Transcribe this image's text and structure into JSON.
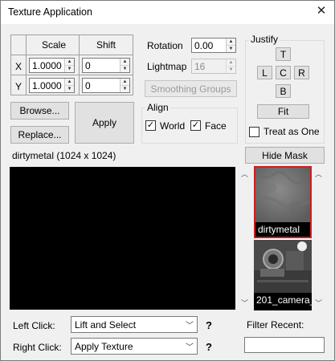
{
  "window": {
    "title": "Texture Application",
    "close_glyph": "✕"
  },
  "grid": {
    "col_scale": "Scale",
    "col_shift": "Shift",
    "row_x": "X",
    "row_y": "Y",
    "x_scale": "1.0000",
    "x_shift": "0",
    "y_scale": "1.0000",
    "y_shift": "0"
  },
  "rotation": {
    "label": "Rotation",
    "value": "0.00"
  },
  "lightmap": {
    "label": "Lightmap",
    "value": "16"
  },
  "smoothing_groups_label": "Smoothing Groups",
  "justify": {
    "label": "Justify",
    "top": "T",
    "left": "L",
    "center": "C",
    "right": "R",
    "bottom": "B",
    "fit": "Fit",
    "treat_as_one": "Treat as One",
    "treat_as_one_checked": false
  },
  "align": {
    "label": "Align",
    "world": "World",
    "world_checked": true,
    "face": "Face",
    "face_checked": true
  },
  "buttons": {
    "browse": "Browse...",
    "replace": "Replace...",
    "apply": "Apply",
    "hide_mask": "Hide Mask"
  },
  "texture_info": "dirtymetal (1024 x 1024)",
  "thumbnails": [
    {
      "name": "dirtymetal",
      "selected": true
    },
    {
      "name": "201_camera_",
      "selected": false
    }
  ],
  "left_click": {
    "label": "Left Click:",
    "value": "Lift and Select",
    "help": "?"
  },
  "right_click": {
    "label": "Right Click:",
    "value": "Apply Texture",
    "help": "?"
  },
  "filter_recent": {
    "label": "Filter Recent:",
    "value": ""
  },
  "colors": {
    "selection": "#cc1f1f",
    "preview_bg": "#000000"
  }
}
